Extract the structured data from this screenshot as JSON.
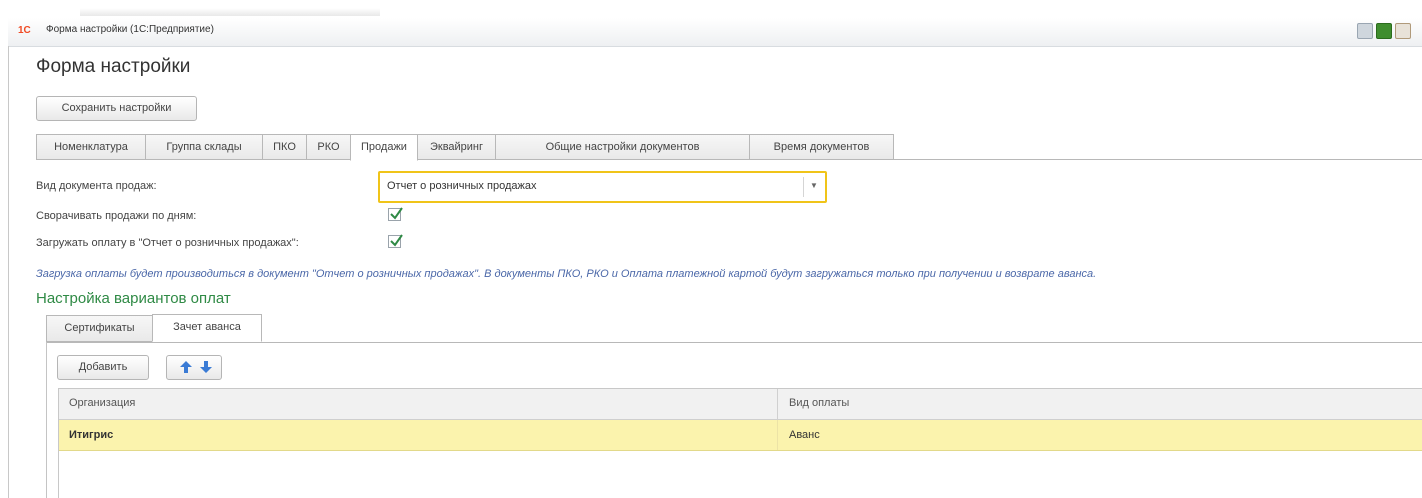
{
  "window": {
    "title": "Форма настройки  (1С:Предприятие)",
    "logo_text": "1С"
  },
  "page": {
    "title": "Форма настройки",
    "save_label": "Сохранить настройки"
  },
  "tabs": [
    {
      "label": "Номенклатура"
    },
    {
      "label": "Группа склады"
    },
    {
      "label": "ПКО"
    },
    {
      "label": "РКО"
    },
    {
      "label": "Продажи",
      "active": true
    },
    {
      "label": "Эквайринг"
    },
    {
      "label": "Общие настройки документов"
    },
    {
      "label": "Время документов"
    }
  ],
  "sales": {
    "doc_type_label": "Вид документа продаж:",
    "doc_type_value": "Отчет о розничных продажах",
    "collapse_label": "Сворачивать продажи по дням:",
    "collapse_checked": true,
    "load_payment_label": "Загружать оплату в \"Отчет о розничных продажах\":",
    "load_payment_checked": true,
    "note": "Загрузка оплаты будет производиться в документ \"Отчет о розничных продажах\". В документы ПКО, РКО и Оплата платежной картой будут загружаться только при получении и возврате аванса."
  },
  "payment_options": {
    "section_title": "Настройка вариантов оплат",
    "tabs": [
      {
        "label": "Сертификаты"
      },
      {
        "label": "Зачет аванса",
        "active": true
      }
    ],
    "add_label": "Добавить",
    "columns": [
      "Организация",
      "Вид оплаты"
    ],
    "rows": [
      {
        "organization": "Итигрис",
        "payment_type": "Аванс",
        "selected": true
      }
    ]
  },
  "colors": {
    "accent_yellow": "#f0c419",
    "selected_row": "#fbf3ad",
    "section_green": "#2f8a45",
    "note_blue": "#4a67a8"
  }
}
